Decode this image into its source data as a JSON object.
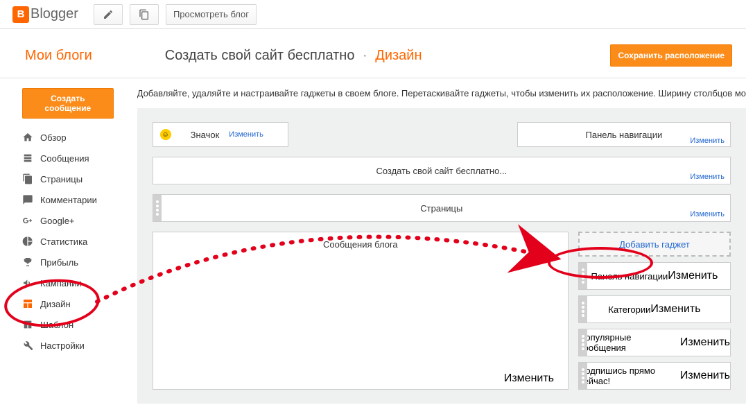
{
  "header": {
    "brand": "Blogger",
    "view_blog": "Просмотреть блог"
  },
  "title": {
    "my_blogs": "Мои блоги",
    "blog_name": "Создать свой сайт бесплатно",
    "section": "Дизайн",
    "save": "Сохранить расположение"
  },
  "intro": "Добавляйте, удаляйте и настраивайте гаджеты в своем блоге. Перетаскивайте гаджеты, чтобы изменить их расположение. Ширину столбцов мо",
  "sidebar": {
    "create": "Создать сообщение",
    "items": [
      {
        "label": "Обзор"
      },
      {
        "label": "Сообщения"
      },
      {
        "label": "Страницы"
      },
      {
        "label": "Комментарии"
      },
      {
        "label": "Google+"
      },
      {
        "label": "Статистика"
      },
      {
        "label": "Прибыль"
      },
      {
        "label": "Кампании"
      },
      {
        "label": "Дизайн"
      },
      {
        "label": "Шаблон"
      },
      {
        "label": "Настройки"
      }
    ]
  },
  "layout": {
    "edit": "Изменить",
    "favicon": "Значок",
    "navbar": "Панель навигации",
    "header": "Создать свой сайт бесплатно...",
    "pages": "Страницы",
    "posts": "Сообщения блога",
    "add_gadget": "Добавить гаджет",
    "widgets": [
      "Панель навигации",
      "Категории",
      "Популярные сообщения",
      "Подпишись прямо сейчас!"
    ]
  }
}
